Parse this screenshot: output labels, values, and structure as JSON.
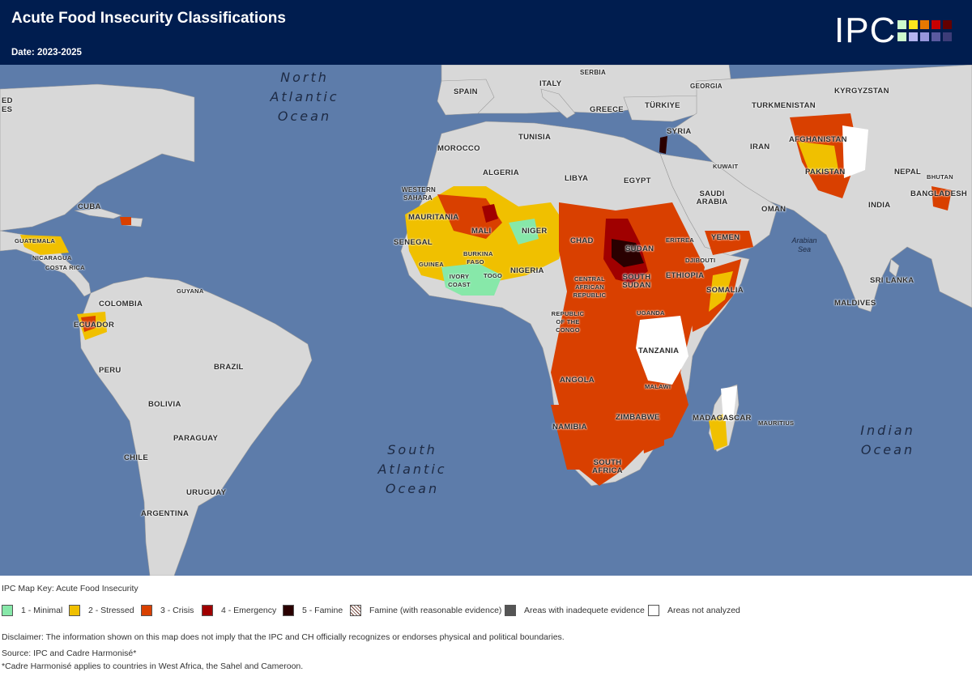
{
  "header": {
    "title": "Acute Food Insecurity Classifications",
    "date": "Date: 2023-2025",
    "logo_text": "IPC",
    "logo_colors": [
      "#cdfacd",
      "#fae61e",
      "#e67800",
      "#c80000",
      "#640000",
      "#7878c8",
      "#9696dc",
      "#b4b4f0",
      "#5a5aa0",
      "#3c3c78"
    ]
  },
  "map": {
    "oceans": [
      {
        "id": "north-atlantic",
        "lines": [
          "North",
          "Atlantic",
          "Ocean"
        ]
      },
      {
        "id": "south-atlantic",
        "lines": [
          "South",
          "Atlantic",
          "Ocean"
        ]
      },
      {
        "id": "indian",
        "lines": [
          "Indian",
          "Ocean"
        ]
      }
    ],
    "seas": [
      {
        "id": "arabian-sea",
        "lines": [
          "Arabian",
          "Sea"
        ]
      }
    ],
    "countries": [
      "ED",
      "ES",
      "SPAIN",
      "ITALY",
      "SERBIA",
      "GEORGIA",
      "KYRGYZSTAN",
      "GREECE",
      "TÜRKIYE",
      "TURKMENISTAN",
      "TUNISIA",
      "MOROCCO",
      "SYRIA",
      "IRAN",
      "AFGHANISTAN",
      "ALGERIA",
      "LIBYA",
      "EGYPT",
      "KUWAIT",
      "PAKISTAN",
      "NEPAL",
      "BHUTAN",
      "BANGLADESH",
      "WESTERN SAHARA",
      "SAUDI ARABIA",
      "OMAN",
      "INDIA",
      "CUBA",
      "MAURITANIA",
      "MALI",
      "NIGER",
      "GUATEMALA",
      "SENEGAL",
      "CHAD",
      "SUDAN",
      "ERITREA",
      "YEMEN",
      "NICARAGUA",
      "GUINEA",
      "BURKINA FASO",
      "DJIBOUTI",
      "COSTA RICA",
      "NIGERIA",
      "IVORY COAST",
      "TOGO",
      "ETHIOPIA",
      "CENTRAL AFRICAN REPUBLIC",
      "SOUTH SUDAN",
      "SOMALIA",
      "SRI LANKA",
      "GUYANA",
      "COLOMBIA",
      "MALDIVES",
      "UGANDA",
      "ECUADOR",
      "REPUBLIC OF THE CONGO",
      "TANZANIA",
      "PERU",
      "BRAZIL",
      "ANGOLA",
      "MALAWI",
      "BOLIVIA",
      "ZIMBABWE",
      "MADAGASCAR",
      "MAURITIUS",
      "PARAGUAY",
      "NAMIBIA",
      "CHILE",
      "SOUTH AFRICA",
      "URUGUAY",
      "ARGENTINA"
    ]
  },
  "legend": {
    "title": "IPC Map Key: Acute Food Insecurity",
    "items": [
      {
        "label": "1 - Minimal",
        "color": "#87e8a9"
      },
      {
        "label": "2 - Stressed",
        "color": "#f0c000"
      },
      {
        "label": "3 - Crisis",
        "color": "#d94000"
      },
      {
        "label": "4 - Emergency",
        "color": "#a00000"
      },
      {
        "label": "5 - Famine",
        "color": "#2a0000"
      },
      {
        "label": "Famine (with reasonable evidence)",
        "color": "hatch"
      },
      {
        "label": "Areas with inadequete evidence",
        "color": "#555555"
      },
      {
        "label": "Areas not analyzed",
        "color": "#ffffff"
      }
    ]
  },
  "footer": {
    "disclaimer": "Disclaimer: The information shown on this map does not imply that the IPC and CH officially recognizes or endorses physical and political boundaries.",
    "source": "Source: IPC and Cadre Harmonisé*",
    "note": "*Cadre Harmonisé applies to countries in West Africa, the Sahel and Cameroon."
  }
}
